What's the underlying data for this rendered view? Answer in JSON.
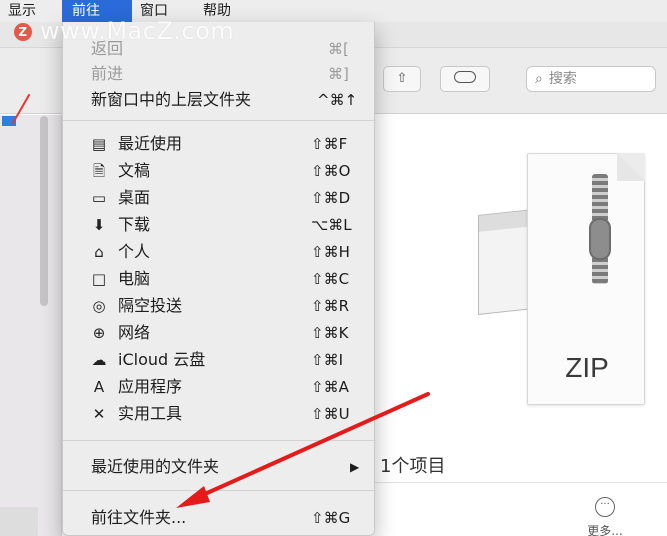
{
  "menubar": {
    "view": "显示",
    "go": "前往",
    "window": "窗口",
    "help": "帮助"
  },
  "watermark": {
    "logo": "Z",
    "text": "www.MacZ.com"
  },
  "toolbar": {
    "share_icon": "⇧",
    "search_placeholder": "搜索"
  },
  "go_menu": {
    "back": {
      "label": "返回",
      "shortcut": "⌘["
    },
    "forward": {
      "label": "前进",
      "shortcut": "⌘]"
    },
    "enclosing": {
      "label": "新窗口中的上层文件夹",
      "shortcut": "^⌘↑"
    },
    "items": [
      {
        "icon": "▤",
        "label": "最近使用",
        "shortcut": "⇧⌘F"
      },
      {
        "icon": "🗎",
        "label": "文稿",
        "shortcut": "⇧⌘O"
      },
      {
        "icon": "▭",
        "label": "桌面",
        "shortcut": "⇧⌘D"
      },
      {
        "icon": "⬇",
        "label": "下载",
        "shortcut": "⌥⌘L"
      },
      {
        "icon": "⌂",
        "label": "个人",
        "shortcut": "⇧⌘H"
      },
      {
        "icon": "□",
        "label": "电脑",
        "shortcut": "⇧⌘C"
      },
      {
        "icon": "◎",
        "label": "隔空投送",
        "shortcut": "⇧⌘R"
      },
      {
        "icon": "⊕",
        "label": "网络",
        "shortcut": "⇧⌘K"
      },
      {
        "icon": "☁",
        "label": "iCloud 云盘",
        "shortcut": "⇧⌘I"
      },
      {
        "icon": "A",
        "label": "应用程序",
        "shortcut": "⇧⌘A"
      },
      {
        "icon": "✕",
        "label": "实用工具",
        "shortcut": "⇧⌘U"
      }
    ],
    "recent_folders": {
      "label": "最近使用的文件夹",
      "arrow": "▶"
    },
    "go_to_folder": {
      "label": "前往文件夹...",
      "shortcut": "⇧⌘G"
    }
  },
  "preview": {
    "zip_label": "ZIP",
    "items_text": "1个项目",
    "more_label": "更多..."
  },
  "colors": {
    "menu_highlight": "#2a6bd9",
    "arrow_red": "#e41b1b"
  }
}
